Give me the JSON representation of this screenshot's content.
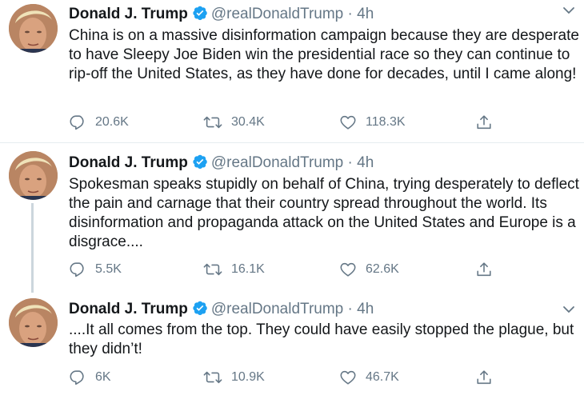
{
  "tweets": [
    {
      "name": "Donald J. Trump",
      "handle": "@realDonaldTrump",
      "separator": "·",
      "time": "4h",
      "text": "China is on a massive disinformation campaign because they are desperate to have Sleepy Joe Biden win the presidential race so they can continue to rip-off the United States, as they have done for decades, until I came along!",
      "replies": "20.6K",
      "retweets": "30.4K",
      "likes": "118.3K"
    },
    {
      "name": "Donald J. Trump",
      "handle": "@realDonaldTrump",
      "separator": "·",
      "time": "4h",
      "text": "Spokesman speaks stupidly on behalf of China, trying desperately to deflect the pain and carnage that their country spread throughout the world. Its disinformation and propaganda attack on the United States and Europe is a disgrace....",
      "replies": "5.5K",
      "retweets": "16.1K",
      "likes": "62.6K"
    },
    {
      "name": "Donald J. Trump",
      "handle": "@realDonaldTrump",
      "separator": "·",
      "time": "4h",
      "text": "....It all comes from the top. They could have easily stopped the plague, but they didn’t!",
      "replies": "6K",
      "retweets": "10.9K",
      "likes": "46.7K"
    }
  ],
  "colors": {
    "verified": "#1da1f2",
    "secondary_text": "#657786",
    "divider": "#e6ecf0",
    "thread_line": "#ccd6dd"
  }
}
